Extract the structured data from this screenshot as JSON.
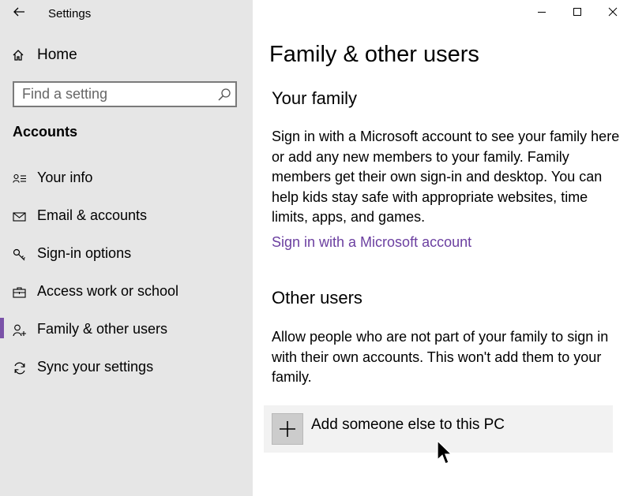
{
  "window": {
    "title": "Settings",
    "controls": {
      "minimize": "minimize-icon",
      "maximize": "maximize-icon",
      "close": "close-icon"
    }
  },
  "sidebar": {
    "home_label": "Home",
    "search_placeholder": "Find a setting",
    "section_label": "Accounts",
    "items": [
      {
        "label": "Your info",
        "icon": "person-card-icon",
        "selected": false
      },
      {
        "label": "Email & accounts",
        "icon": "mail-icon",
        "selected": false
      },
      {
        "label": "Sign-in options",
        "icon": "key-icon",
        "selected": false
      },
      {
        "label": "Access work or school",
        "icon": "briefcase-icon",
        "selected": false
      },
      {
        "label": "Family & other users",
        "icon": "person-add-icon",
        "selected": true
      },
      {
        "label": "Sync your settings",
        "icon": "sync-icon",
        "selected": false
      }
    ]
  },
  "main": {
    "title": "Family & other users",
    "family": {
      "heading": "Your family",
      "description": "Sign in with a Microsoft account to see your family here or add any new members to your family. Family members get their own sign-in and desktop. You can help kids stay safe with appropriate websites, time limits, apps, and games.",
      "link": "Sign in with a Microsoft account"
    },
    "other_users": {
      "heading": "Other users",
      "description": "Allow people who are not part of your family to sign in with their own accounts. This won't add them to your family.",
      "add_label": "Add someone else to this PC"
    }
  },
  "colors": {
    "accent": "#7a52a8",
    "link": "#6b3fa0",
    "sidebar_bg": "#e6e6e6"
  }
}
